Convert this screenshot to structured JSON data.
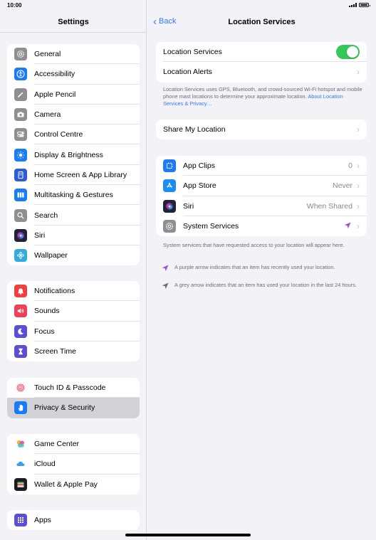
{
  "status": {
    "time": "10:00"
  },
  "sidebar": {
    "title": "Settings",
    "groups": [
      {
        "items": [
          {
            "label": "General",
            "icon": "gear-icon",
            "color": "#8e8e93"
          },
          {
            "label": "Accessibility",
            "icon": "accessibility-icon",
            "color": "#1a7cf5"
          },
          {
            "label": "Apple Pencil",
            "icon": "pencil-icon",
            "color": "#8e8e93"
          },
          {
            "label": "Camera",
            "icon": "camera-icon",
            "color": "#8e8e93"
          },
          {
            "label": "Control Centre",
            "icon": "switches-icon",
            "color": "#8e8e93"
          },
          {
            "label": "Display & Brightness",
            "icon": "sun-icon",
            "color": "#1a7cf5"
          },
          {
            "label": "Home Screen & App Library",
            "icon": "home-screen-icon",
            "color": "#2e5cd6"
          },
          {
            "label": "Multitasking & Gestures",
            "icon": "multitasking-icon",
            "color": "#1a7cf5"
          },
          {
            "label": "Search",
            "icon": "search-icon",
            "color": "#8e8e93"
          },
          {
            "label": "Siri",
            "icon": "siri-icon",
            "color": "#222233"
          },
          {
            "label": "Wallpaper",
            "icon": "flower-icon",
            "color": "#35aadc"
          }
        ]
      },
      {
        "items": [
          {
            "label": "Notifications",
            "icon": "bell-icon",
            "color": "#ee4040"
          },
          {
            "label": "Sounds",
            "icon": "speaker-icon",
            "color": "#ee4056"
          },
          {
            "label": "Focus",
            "icon": "moon-icon",
            "color": "#5b4fd6"
          },
          {
            "label": "Screen Time",
            "icon": "hourglass-icon",
            "color": "#5b4fd6"
          }
        ]
      },
      {
        "items": [
          {
            "label": "Touch ID & Passcode",
            "icon": "fingerprint-icon",
            "color": "#ffffff"
          },
          {
            "label": "Privacy & Security",
            "icon": "hand-icon",
            "color": "#1a7cf5"
          }
        ]
      },
      {
        "items": [
          {
            "label": "Game Center",
            "icon": "game-center-icon",
            "color": "#ffffff"
          },
          {
            "label": "iCloud",
            "icon": "cloud-icon",
            "color": "#ffffff"
          },
          {
            "label": "Wallet & Apple Pay",
            "icon": "wallet-icon",
            "color": "#1c1c1e"
          }
        ]
      },
      {
        "items": [
          {
            "label": "Apps",
            "icon": "apps-grid-icon",
            "color": "#5b4fd6"
          }
        ]
      }
    ]
  },
  "detail": {
    "back_label": "Back",
    "title": "Location Services",
    "location_services_label": "Location Services",
    "location_services_on": true,
    "location_alerts_label": "Location Alerts",
    "description": "Location Services uses GPS, Bluetooth, and crowd-sourced Wi-Fi hotspot and mobile phone mast locations to determine your approximate location.",
    "about_link": "About Location Services & Privacy…",
    "share_label": "Share My Location",
    "apps": [
      {
        "label": "App Clips",
        "value": "0",
        "icon": "app-clips-icon",
        "color": "#1a7cf5"
      },
      {
        "label": "App Store",
        "value": "Never",
        "icon": "app-store-icon",
        "color": "#1a8cf5"
      },
      {
        "label": "Siri",
        "value": "When Shared",
        "icon": "siri-icon",
        "color": "#222233"
      },
      {
        "label": "System Services",
        "value": "",
        "icon": "gear-icon",
        "color": "#8e8e93"
      }
    ],
    "system_note": "System services that have requested access to your location will appear here.",
    "purple_note": "A purple arrow indicates that an item has recently used your location.",
    "grey_note": "A grey arrow indicates that an item has used your location in the last 24 hours."
  },
  "colors": {
    "accent": "#3478f6",
    "toggle_on": "#34c759",
    "purple_arrow": "#9b4fd6",
    "grey_arrow": "#6d6d72"
  }
}
